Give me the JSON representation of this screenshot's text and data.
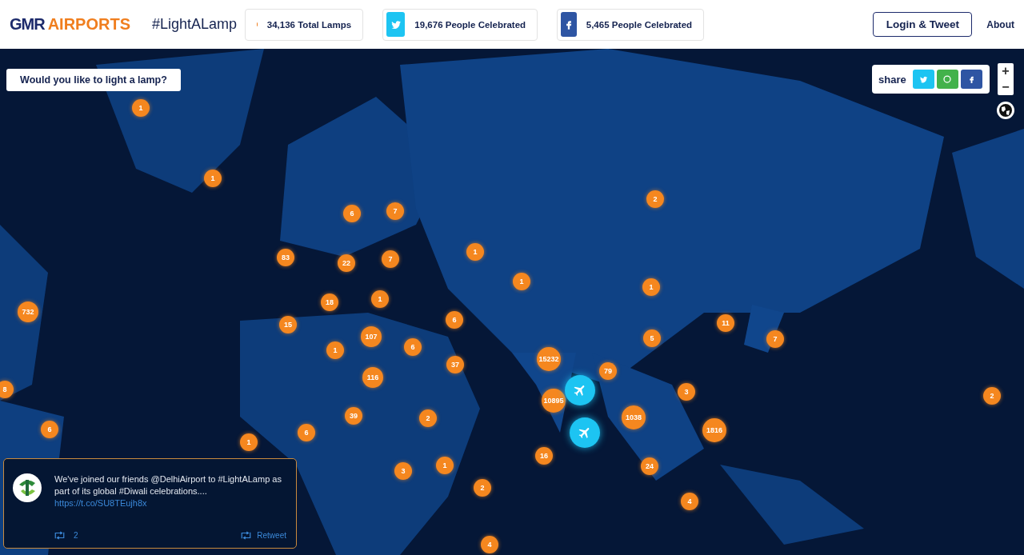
{
  "header": {
    "logo": {
      "mark": "GMR",
      "word": "AIRPORTS"
    },
    "hashtag": "#LightALamp",
    "stats": [
      {
        "kind": "lamps",
        "text": "34,136 Total Lamps"
      },
      {
        "kind": "twitter",
        "text": "19,676 People Celebrated"
      },
      {
        "kind": "facebook",
        "text": "5,465 People Celebrated"
      }
    ],
    "login_button": "Login & Tweet",
    "about_link": "About"
  },
  "map": {
    "kind": "picture",
    "prompt_button": "Would you like to light a lamp?",
    "share": {
      "label": "share",
      "buttons": [
        {
          "kind": "twitter"
        },
        {
          "kind": "whatsapp"
        },
        {
          "kind": "facebook"
        }
      ]
    },
    "zoom": [
      "+",
      "−"
    ],
    "markers": [
      {
        "kind": "lamp",
        "count": "1"
      },
      {
        "kind": "lamp",
        "count": "1"
      },
      {
        "kind": "lamp",
        "count": "6"
      },
      {
        "kind": "lamp",
        "count": "7"
      },
      {
        "kind": "lamp",
        "count": "83"
      },
      {
        "kind": "lamp",
        "count": "22"
      },
      {
        "kind": "lamp",
        "count": "7"
      },
      {
        "kind": "lamp",
        "count": "1"
      },
      {
        "kind": "lamp",
        "count": "1"
      },
      {
        "kind": "lamp",
        "count": "2"
      },
      {
        "kind": "lamp",
        "count": "1"
      },
      {
        "kind": "lamp",
        "count": "732"
      },
      {
        "kind": "lamp",
        "count": "18"
      },
      {
        "kind": "lamp",
        "count": "1"
      },
      {
        "kind": "lamp",
        "count": "15"
      },
      {
        "kind": "lamp",
        "count": "6"
      },
      {
        "kind": "lamp",
        "count": "107"
      },
      {
        "kind": "lamp",
        "count": "6"
      },
      {
        "kind": "lamp",
        "count": "1"
      },
      {
        "kind": "lamp",
        "count": "11"
      },
      {
        "kind": "lamp",
        "count": "5"
      },
      {
        "kind": "lamp",
        "count": "7"
      },
      {
        "kind": "lamp",
        "count": "15232"
      },
      {
        "kind": "lamp",
        "count": "37"
      },
      {
        "kind": "lamp",
        "count": "116"
      },
      {
        "kind": "lamp",
        "count": "79"
      },
      {
        "kind": "lamp",
        "count": "8"
      },
      {
        "kind": "lamp",
        "count": "3"
      },
      {
        "kind": "lamp",
        "count": "10895"
      },
      {
        "kind": "lamp",
        "count": "2"
      },
      {
        "kind": "lamp",
        "count": "39"
      },
      {
        "kind": "lamp",
        "count": "2"
      },
      {
        "kind": "lamp",
        "count": "1038"
      },
      {
        "kind": "lamp",
        "count": "6"
      },
      {
        "kind": "lamp",
        "count": "6"
      },
      {
        "kind": "lamp",
        "count": "1816"
      },
      {
        "kind": "lamp",
        "count": "1"
      },
      {
        "kind": "lamp",
        "count": "16"
      },
      {
        "kind": "lamp",
        "count": "3"
      },
      {
        "kind": "lamp",
        "count": "1"
      },
      {
        "kind": "lamp",
        "count": "24"
      },
      {
        "kind": "lamp",
        "count": "2"
      },
      {
        "kind": "lamp",
        "count": "4"
      },
      {
        "kind": "lamp",
        "count": "4"
      },
      {
        "kind": "airport"
      },
      {
        "kind": "airport"
      }
    ],
    "tweet": {
      "text": "We've joined our friends @DelhiAirport to #LightALamp as part of its global #Diwali celebrations....",
      "link": "https://t.co/SU8TEujh8x",
      "retweet_count": "2",
      "retweet_button": "Retweet"
    }
  }
}
